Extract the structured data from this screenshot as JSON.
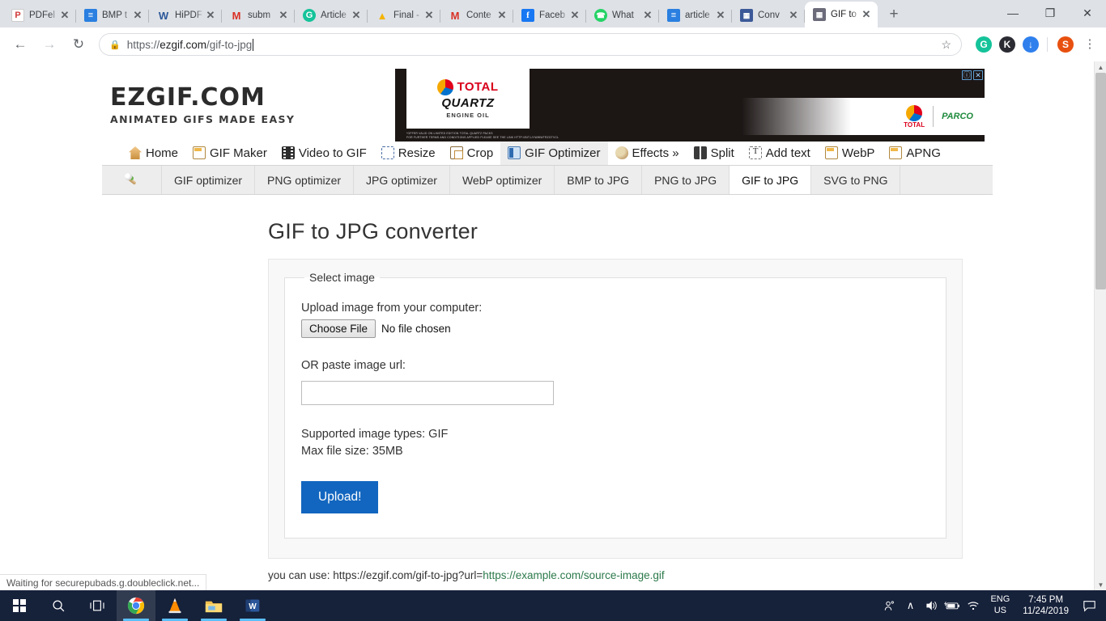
{
  "browser": {
    "tabs": [
      {
        "title": "PDFel",
        "favicon_name": "pdfelement-icon",
        "favicon_text": "P",
        "favicon_bg": "#ffffff",
        "favicon_fg": "#d13b3b",
        "active": false
      },
      {
        "title": "BMP t",
        "favicon_name": "document-blue-icon",
        "favicon_text": "≡",
        "favicon_bg": "#2a7fe0",
        "favicon_fg": "#ffffff",
        "active": false
      },
      {
        "title": "HiPDF",
        "favicon_name": "word-w-icon",
        "favicon_text": "W",
        "favicon_bg": "#ffffff",
        "favicon_fg": "#2b579a",
        "active": false
      },
      {
        "title": "subm",
        "favicon_name": "gmail-icon",
        "favicon_text": "M",
        "favicon_bg": "#ffffff",
        "favicon_fg": "#d93025",
        "active": false
      },
      {
        "title": "Article",
        "favicon_name": "grammarly-icon",
        "favicon_text": "G",
        "favicon_bg": "#15c39a",
        "favicon_fg": "#ffffff",
        "active": false
      },
      {
        "title": "Final -",
        "favicon_name": "google-drive-icon",
        "favicon_text": "▲",
        "favicon_bg": "#ffffff",
        "favicon_fg": "#f4b400",
        "active": false
      },
      {
        "title": "Conte",
        "favicon_name": "gmail-icon",
        "favicon_text": "M",
        "favicon_bg": "#ffffff",
        "favicon_fg": "#d93025",
        "active": false
      },
      {
        "title": "Faceb",
        "favicon_name": "facebook-icon",
        "favicon_text": "f",
        "favicon_bg": "#1877f2",
        "favicon_fg": "#ffffff",
        "active": false
      },
      {
        "title": "What",
        "favicon_name": "whatsapp-icon",
        "favicon_text": "✆",
        "favicon_bg": "#25d366",
        "favicon_fg": "#ffffff",
        "active": false
      },
      {
        "title": "article",
        "favicon_name": "document-blue-icon",
        "favicon_text": "≡",
        "favicon_bg": "#2a7fe0",
        "favicon_fg": "#ffffff",
        "active": false
      },
      {
        "title": "Conv",
        "favicon_name": "convert-icon",
        "favicon_text": "◨",
        "favicon_bg": "#3b5998",
        "favicon_fg": "#ffffff",
        "active": false
      },
      {
        "title": "GIF to",
        "favicon_name": "ezgif-icon",
        "favicon_text": "▦",
        "favicon_bg": "#6b6b7a",
        "favicon_fg": "#ffffff",
        "active": true
      }
    ],
    "tab_close_glyph": "✕",
    "new_tab_glyph": "+",
    "window_controls": {
      "minimize": "—",
      "maximize": "❐",
      "close": "✕"
    },
    "nav": {
      "back": "←",
      "forward": "→",
      "reload": "↻"
    },
    "omnibox": {
      "lock_glyph": "🔒",
      "url_scheme": "https://",
      "url_host": "ezgif.com",
      "url_path": "/gif-to-jpg",
      "star_glyph": "☆"
    },
    "extensions": [
      {
        "name": "grammarly-extension-icon",
        "letter": "G",
        "bg": "#15c39a"
      },
      {
        "name": "kami-extension-icon",
        "letter": "K",
        "bg": "#2b2b33"
      },
      {
        "name": "download-extension-icon",
        "letter": "↓",
        "bg": "#2f80ed"
      },
      {
        "name": "profile-avatar",
        "letter": "S",
        "bg": "#e8500f"
      }
    ],
    "menu_glyph": "⋮",
    "status_text": "Waiting for securepubads.g.doubleclick.net..."
  },
  "site": {
    "logo": {
      "line1": "EZGIF.COM",
      "line2": "ANIMATED GIFS MADE EASY"
    },
    "ad": {
      "brand": "TOTAL",
      "product": "QUARTZ",
      "subtitle": "ENGINE OIL",
      "fineprint_line1": "*OFFER VALID ON LIMITED EDITION TOTAL QUARTZ PACKS",
      "fineprint_line2": "FOR FURTHER TERMS AND CONDITIONS APPLIED PLEASE SEE THE LINK HTTP://BIT.LY/WWWTRZGTVCL",
      "partner": "PARCO",
      "info_glyph": "ⓘ",
      "close_glyph": "✕"
    },
    "main_nav": [
      {
        "label": "Home",
        "icon": "home-icon",
        "icon_class": "ic-home",
        "active": false
      },
      {
        "label": "GIF Maker",
        "icon": "gif-maker-icon",
        "icon_class": "ic-window",
        "active": false
      },
      {
        "label": "Video to GIF",
        "icon": "film-icon",
        "icon_class": "ic-film",
        "active": false
      },
      {
        "label": "Resize",
        "icon": "resize-icon",
        "icon_class": "ic-resize",
        "active": false
      },
      {
        "label": "Crop",
        "icon": "crop-icon",
        "icon_class": "ic-crop",
        "active": false
      },
      {
        "label": "GIF Optimizer",
        "icon": "optimizer-icon",
        "icon_class": "ic-opt",
        "active": true
      },
      {
        "label": "Effects »",
        "icon": "palette-icon",
        "icon_class": "ic-palette",
        "active": false
      },
      {
        "label": "Split",
        "icon": "split-icon",
        "icon_class": "ic-split",
        "active": false
      },
      {
        "label": "Add text",
        "icon": "add-text-icon",
        "icon_class": "ic-text",
        "active": false
      },
      {
        "label": "WebP",
        "icon": "webp-icon",
        "icon_class": "ic-webp",
        "active": false
      },
      {
        "label": "APNG",
        "icon": "apng-icon",
        "icon_class": "ic-apng",
        "active": false
      }
    ],
    "sub_nav": [
      {
        "label": "GIF optimizer",
        "active": false
      },
      {
        "label": "PNG optimizer",
        "active": false
      },
      {
        "label": "JPG optimizer",
        "active": false
      },
      {
        "label": "WebP optimizer",
        "active": false
      },
      {
        "label": "BMP to JPG",
        "active": false
      },
      {
        "label": "PNG to JPG",
        "active": false
      },
      {
        "label": "GIF to JPG",
        "active": true
      },
      {
        "label": "SVG to PNG",
        "active": false
      }
    ],
    "page_title": "GIF to JPG converter",
    "form": {
      "legend": "Select image",
      "upload_label": "Upload image from your computer:",
      "choose_file_button": "Choose File",
      "no_file_text": "No file chosen",
      "url_label": "OR paste image url:",
      "url_value": "",
      "url_placeholder": "",
      "supported_types": "Supported image types: GIF",
      "max_file_size": "Max file size: 35MB",
      "upload_button": "Upload!"
    },
    "below_text": {
      "prefix": "you can use: https://ezgif.com/gif-to-jpg?url=",
      "link": "https://example.com/source-image.gif"
    }
  },
  "taskbar": {
    "buttons": [
      {
        "name": "start-button",
        "glyph": "",
        "running": false,
        "active": false
      },
      {
        "name": "search-icon",
        "glyph": "⌕",
        "running": false,
        "active": false
      },
      {
        "name": "task-view-icon",
        "glyph": "⌸",
        "running": false,
        "active": false
      },
      {
        "name": "chrome-taskbar-icon",
        "glyph": "",
        "running": true,
        "active": true
      },
      {
        "name": "vlc-taskbar-icon",
        "glyph": "",
        "running": true,
        "active": false
      },
      {
        "name": "file-explorer-taskbar-icon",
        "glyph": "",
        "running": true,
        "active": false
      },
      {
        "name": "word-taskbar-icon",
        "glyph": "W",
        "running": true,
        "active": false
      }
    ],
    "tray": {
      "people_glyph": "☺",
      "chevron_glyph": "∧",
      "volume_glyph": "🔊",
      "battery_glyph": "▄",
      "wifi_glyph": "◠",
      "lang_line1": "ENG",
      "lang_line2": "US",
      "time": "7:45 PM",
      "date": "11/24/2019",
      "notification_glyph": "▭"
    }
  }
}
